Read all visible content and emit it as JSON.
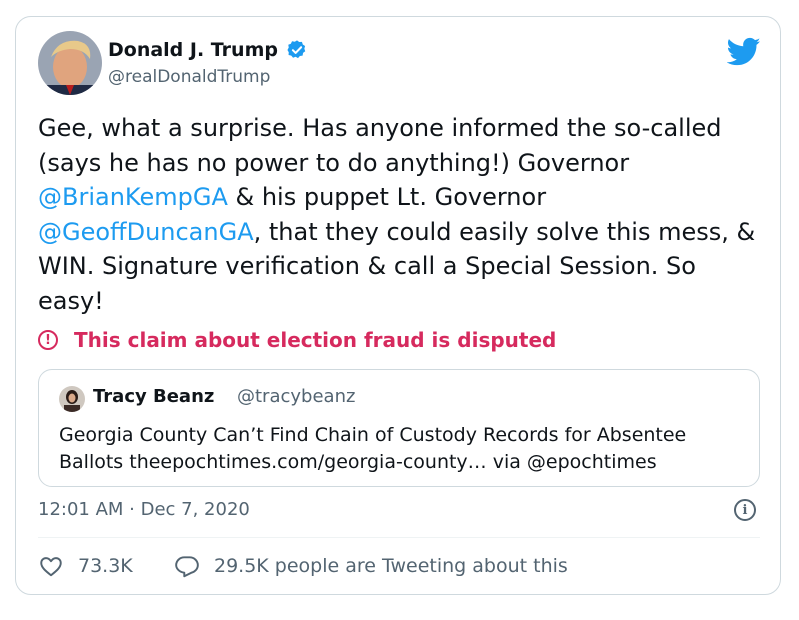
{
  "author": {
    "name": "Donald J. Trump",
    "handle": "@realDonaldTrump",
    "verified": true
  },
  "tweet": {
    "text_1": "Gee, what a surprise. Has anyone informed the so-called (says he has no power to do anything!) Governor ",
    "mention_1": "@BrianKempGA",
    "text_2": " & his puppet Lt. Governor ",
    "mention_2": "@GeoffDuncanGA",
    "text_3": ", that they could easily solve this mess, & WIN. Signature verification & call a Special Session. So easy!"
  },
  "label": {
    "icon": "exclamation-circle-icon",
    "text": "This claim about election fraud is disputed"
  },
  "quote": {
    "name": "Tracy Beanz",
    "handle": "@tracybeanz",
    "text": "Georgia County Can’t Find Chain of Custody Records for Absentee Ballots theepochtimes.com/georgia-county… via @epochtimes"
  },
  "timestamp": "12:01 AM · Dec 7, 2020",
  "stats": {
    "likes": "73.3K",
    "replies": "29.5K people are Tweeting about this"
  },
  "colors": {
    "link": "#1d9bf0",
    "disputed": "#d62a5e",
    "muted": "#536471",
    "twitter_blue": "#1d9bf0"
  }
}
